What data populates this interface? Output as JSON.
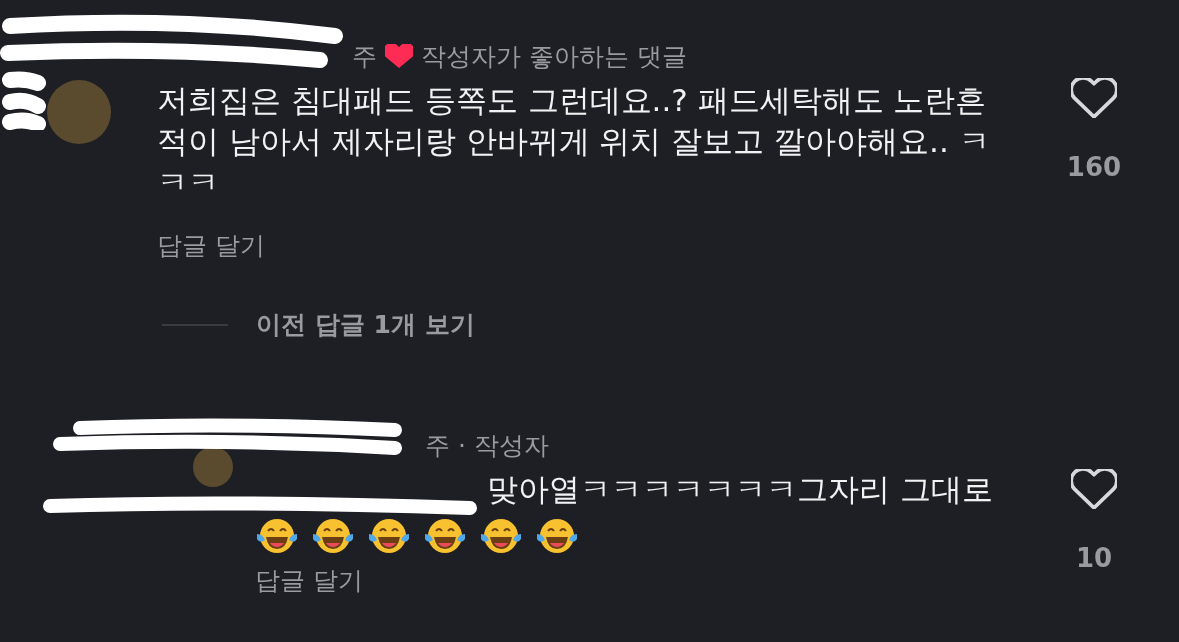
{
  "comments": [
    {
      "header": {
        "time": "주",
        "liked_by_author": true,
        "badge": "작성자가 좋아하는 댓글"
      },
      "body": "저희집은 침대패드 등쪽도 그런데요..? 패드세탁해도 노란흔적이 남아서 제자리랑 안바뀌게 위치 잘보고 깔아야해요.. ㅋㅋㅋ",
      "liked": false,
      "like_count": "160",
      "reply_action": "답글 달기",
      "replies_toggle": {
        "label": "이전 답글 1개 보기"
      },
      "replies": [
        {
          "header": {
            "time": "주",
            "author_tag": "· 작성자"
          },
          "body": "맞아열ㅋㅋㅋㅋㅋㅋㅋ그자리 그대로",
          "emojis": [
            {
              "kind": "laugh_cry"
            },
            {
              "kind": "laugh_cry"
            },
            {
              "kind": "laugh_cry"
            },
            {
              "kind": "laugh_cry"
            },
            {
              "kind": "laugh_cry"
            },
            {
              "kind": "laugh_cry"
            }
          ],
          "liked": false,
          "like_count": "10",
          "reply_action": "답글 달기"
        }
      ]
    }
  ]
}
